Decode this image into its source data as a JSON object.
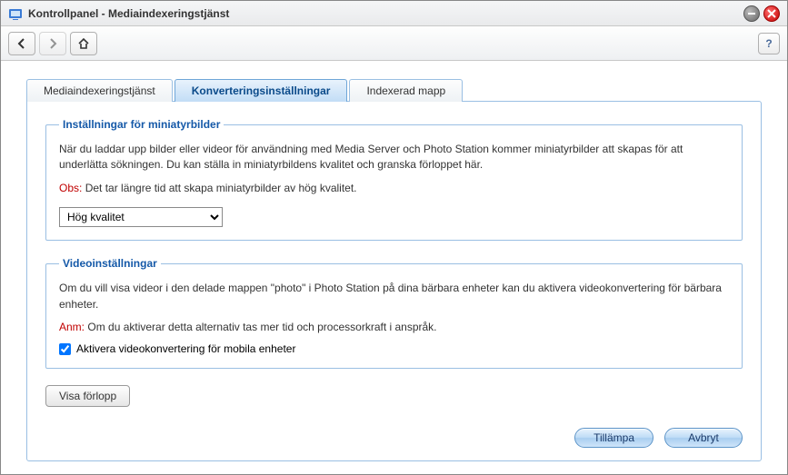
{
  "window": {
    "title": "Kontrollpanel - Mediaindexeringstjänst"
  },
  "toolbar": {
    "help": "?"
  },
  "tabs": [
    {
      "label": "Mediaindexeringstjänst"
    },
    {
      "label": "Konverteringsinställningar"
    },
    {
      "label": "Indexerad mapp"
    }
  ],
  "thumb": {
    "legend": "Inställningar för miniatyrbilder",
    "desc": "När du laddar upp bilder eller videor för användning med Media Server och Photo Station kommer miniatyrbilder att skapas för att underlätta sökningen. Du kan ställa in miniatyrbildens kvalitet och granska förloppet här.",
    "note_label": "Obs:",
    "note_text": "Det tar längre tid att skapa miniatyrbilder av hög kvalitet.",
    "selected": "Hög kvalitet"
  },
  "video": {
    "legend": "Videoinställningar",
    "desc": "Om du vill visa videor i den delade mappen \"photo\" i Photo Station på dina bärbara enheter kan du aktivera videokonvertering för bärbara enheter.",
    "note_label": "Anm:",
    "note_text": "Om du aktiverar detta alternativ tas mer tid och processorkraft i anspråk.",
    "checkbox_label": "Aktivera videokonvertering för mobila enheter"
  },
  "buttons": {
    "progress": "Visa förlopp",
    "apply": "Tillämpa",
    "cancel": "Avbryt"
  }
}
